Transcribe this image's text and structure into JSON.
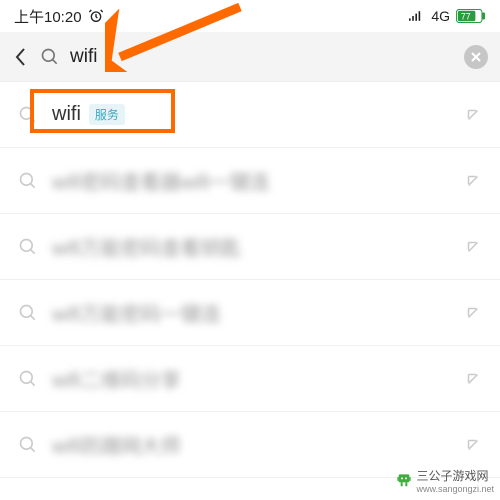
{
  "status_bar": {
    "time": "上午10:20",
    "network": "4G",
    "battery_text": "77"
  },
  "search": {
    "query": "wifi"
  },
  "results": [
    {
      "text": "wifi",
      "badge": "服务",
      "blurred": false
    },
    {
      "text": "wifi密码查看器wifi一键连",
      "badge": null,
      "blurred": true
    },
    {
      "text": "wifi万能密码查看钥匙",
      "badge": null,
      "blurred": true
    },
    {
      "text": "wifi万能密码一键连",
      "badge": null,
      "blurred": true
    },
    {
      "text": "wifi二维码分享",
      "badge": null,
      "blurred": true
    },
    {
      "text": "wifi防蹭网大师",
      "badge": null,
      "blurred": true
    }
  ],
  "watermark": {
    "text": "三公子游戏网",
    "url": "www.sangongzi.net"
  },
  "colors": {
    "highlight": "#ff6a00",
    "badge_bg": "#e6f4f7",
    "badge_text": "#3ba9bd"
  }
}
